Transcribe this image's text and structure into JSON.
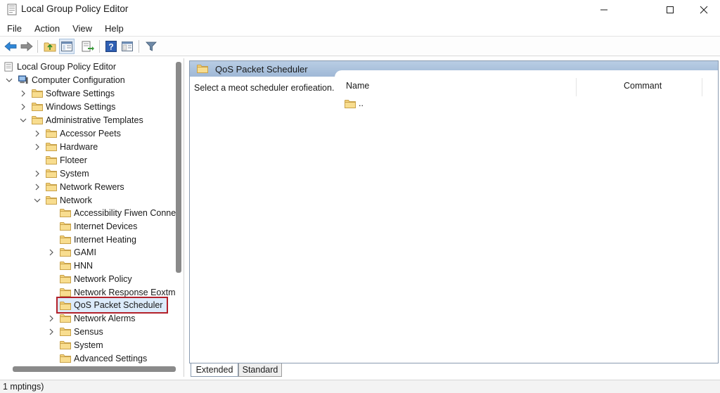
{
  "window": {
    "title": "Local Group Policy Editor",
    "controls": [
      "minimize-icon",
      "maximize-icon",
      "close-icon"
    ]
  },
  "menu": [
    "File",
    "Action",
    "View",
    "Help"
  ],
  "toolbar": [
    "back-arrow-icon",
    "forward-arrow-icon",
    "up-folder-icon",
    "show-hide-tree-icon",
    "export-list-icon",
    "help-icon",
    "properties-icon",
    "filter-icon"
  ],
  "tree": {
    "root": "Local Group Policy Editor",
    "computer_configuration": "Computer Configuration",
    "software_settings": "Software Settings",
    "windows_settings": "Windows Settings",
    "administrative_templates": "Administrative Templates",
    "accessor_peets": "Accessor Peets",
    "hardware": "Hardware",
    "floteer": "Floteer",
    "system": "System",
    "network_rewers": "Network Rewers",
    "network": "Network",
    "accessibility": "Accessibility Fiwen Connec",
    "internet_devices": "Internet Devices",
    "internet_heating": "Internet Heating",
    "gami": "GAMI",
    "hnn": "HNN",
    "network_policy": "Network Policy",
    "network_response": "Network Response Eoxtm",
    "qos": "QoS Packet Scheduler",
    "network_alerms": "Network Alerms",
    "sensus": "Sensus",
    "system2": "System",
    "advanced_settings": "Advanced Settings"
  },
  "right_pane": {
    "title": "QoS Packet Scheduler",
    "description": "Select a meot scheduler erofieation.",
    "columns": [
      "Name",
      "Commant"
    ],
    "rows": [
      ".."
    ]
  },
  "tabs": [
    "Extended",
    "Standard"
  ],
  "status": "1 mptings)",
  "colors": {
    "selection_border": "#b3202a",
    "selection_fill": "#dcebfb",
    "header_blue": "#a8c0dc",
    "folder_yellow": "#f3d27a"
  }
}
